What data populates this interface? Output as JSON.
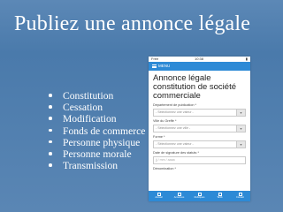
{
  "slide": {
    "title": "Publiez une annonce légale",
    "bullets": [
      "Constitution",
      "Cessation",
      "Modification",
      "Fonds de commerce",
      "Personne physique",
      "Personne morale",
      "Transmission"
    ]
  },
  "phone": {
    "status": {
      "carrier": "Free",
      "time": "10:38"
    },
    "nav": {
      "menu_label": "MENU"
    },
    "title": "Annonce légale constitution de société commerciale",
    "fields": {
      "department_label": "Département de publication *",
      "department_placeholder": "- Sélectionnez une valeur -",
      "city_label": "Ville du Greffe *",
      "city_placeholder": "- Sélectionnez une ville -",
      "form_label": "Forme *",
      "form_placeholder": "- Sélectionnez une valeur -",
      "date_label": "Date de signature des statuts *",
      "date_placeholder": "jj / mm / aaaa",
      "name_label": "Dénomination *"
    },
    "tabs": [
      "Accueil",
      "Annonces",
      "Rubriques",
      "Tarifs",
      "Contact"
    ]
  }
}
